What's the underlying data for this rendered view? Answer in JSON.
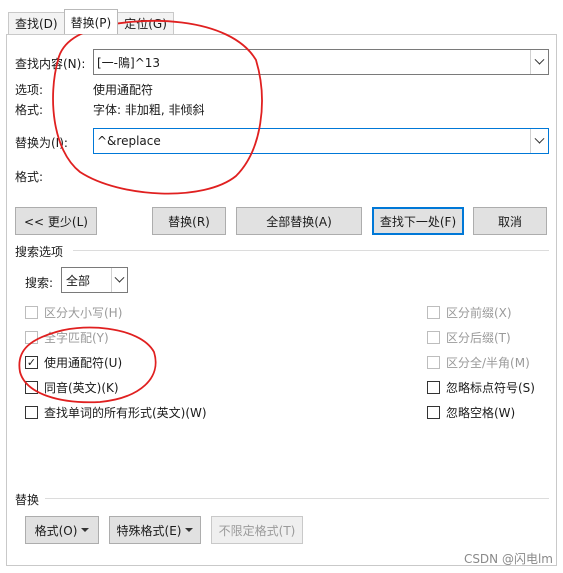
{
  "tabs": [
    {
      "label": "查找(D)"
    },
    {
      "label": "替换(P)"
    },
    {
      "label": "定位(G)"
    }
  ],
  "find": {
    "label": "查找内容(N):",
    "value": "[一-隝]^13",
    "options_label": "选项:",
    "options_value": "使用通配符",
    "format_label": "格式:",
    "format_value": "字体: 非加粗, 非倾斜"
  },
  "replace": {
    "label": "替换为(I):",
    "value": "^&replace",
    "format_label": "格式:"
  },
  "buttons": {
    "less": "<< 更少(L)",
    "replace": "替换(R)",
    "replace_all": "全部替换(A)",
    "find_next": "查找下一处(F)",
    "cancel": "取消"
  },
  "search_options": {
    "heading": "搜索选项",
    "search_label": "搜索:",
    "search_value": "全部",
    "left": [
      {
        "label": "区分大小写(H)",
        "checked": false,
        "disabled": true
      },
      {
        "label": "全字匹配(Y)",
        "checked": false,
        "disabled": true
      },
      {
        "label": "使用通配符(U)",
        "checked": true,
        "disabled": false
      },
      {
        "label": "同音(英文)(K)",
        "checked": false,
        "disabled": false
      },
      {
        "label": "查找单词的所有形式(英文)(W)",
        "checked": false,
        "disabled": false
      }
    ],
    "right": [
      {
        "label": "区分前缀(X)",
        "checked": false,
        "disabled": true
      },
      {
        "label": "区分后缀(T)",
        "checked": false,
        "disabled": true
      },
      {
        "label": "区分全/半角(M)",
        "checked": false,
        "disabled": true
      },
      {
        "label": "忽略标点符号(S)",
        "checked": false,
        "disabled": false
      },
      {
        "label": "忽略空格(W)",
        "checked": false,
        "disabled": false
      }
    ]
  },
  "replace_section": {
    "heading": "替换",
    "format_btn": "格式(O)",
    "special_btn": "特殊格式(E)",
    "no_format_btn": "不限定格式(T)"
  },
  "check_mark": "✓",
  "watermark": "CSDN @闪电lm",
  "colors": {
    "annotation": "#e02020",
    "focus": "#0078d7"
  }
}
